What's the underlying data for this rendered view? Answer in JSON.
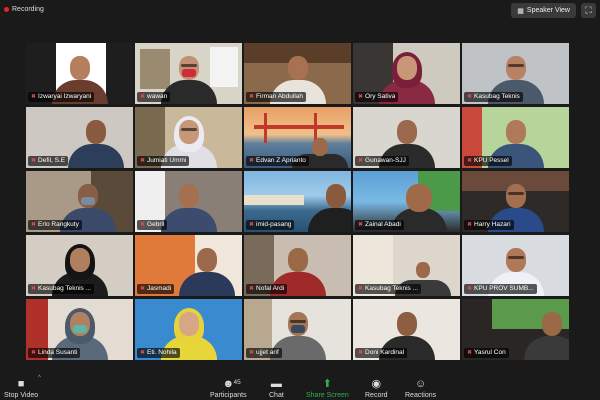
{
  "window": {
    "recording_label": "Recording",
    "speaker_view_label": "Speaker View",
    "fullscreen_icon": "fullscreen-icon"
  },
  "participants": [
    {
      "name": "Izwaryai Izwaryani"
    },
    {
      "name": "wawan"
    },
    {
      "name": "Firman Abdullah"
    },
    {
      "name": "Ory Sativa"
    },
    {
      "name": "Kasubag Teknis"
    },
    {
      "name": "Defil, S.E"
    },
    {
      "name": "Jumiati Ummi"
    },
    {
      "name": "Edvan Z Aprianto"
    },
    {
      "name": "Gunawan-SJJ"
    },
    {
      "name": "KPU Pessel"
    },
    {
      "name": "Erlo Rangkuty"
    },
    {
      "name": "Gebril"
    },
    {
      "name": "imid-pasang"
    },
    {
      "name": "Zainal Abadi"
    },
    {
      "name": "Harry Hazari"
    },
    {
      "name": "Kasubag Teknis ..."
    },
    {
      "name": "Jasmadi"
    },
    {
      "name": "Nofal Ardi"
    },
    {
      "name": "Kasubag Teknis ..."
    },
    {
      "name": "KPU PROV SUMB..."
    },
    {
      "name": "Linda Susanti"
    },
    {
      "name": "Eti. Nohila"
    },
    {
      "name": "ujjet arif"
    },
    {
      "name": "Doni Kardinal"
    },
    {
      "name": "Yasrul Con"
    }
  ],
  "toolbar": {
    "stop_video": "Stop Video",
    "participants": "Participants",
    "participant_count": "45",
    "chat": "Chat",
    "share_screen": "Share Screen",
    "record": "Record",
    "reactions": "Reactions"
  },
  "colors": {
    "active_speaker_border": "#d8f26a",
    "share_green": "#2fb24c",
    "muted_red": "#e14b4b"
  }
}
